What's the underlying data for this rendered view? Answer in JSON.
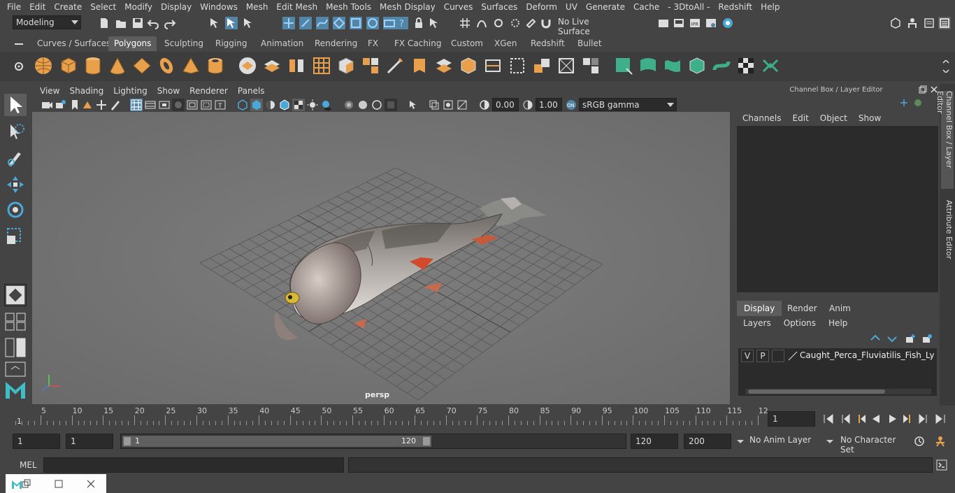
{
  "menubar": {
    "items": [
      "File",
      "Edit",
      "Create",
      "Select",
      "Modify",
      "Display",
      "Windows",
      "Mesh",
      "Edit Mesh",
      "Mesh Tools",
      "Mesh Display",
      "Curves",
      "Surfaces",
      "Deform",
      "UV",
      "Generate",
      "Cache",
      "- 3DtoAll -",
      "Redshift",
      "Help"
    ]
  },
  "statusline": {
    "mode": "Modeling",
    "live_surface": "No Live Surface"
  },
  "shelf": {
    "tabs": [
      "Curves / Surfaces",
      "Polygons",
      "Sculpting",
      "Rigging",
      "Animation",
      "Rendering",
      "FX",
      "FX Caching",
      "Custom",
      "XGen",
      "Redshift",
      "Bullet"
    ],
    "active_tab": "Polygons"
  },
  "viewport": {
    "menu": [
      "View",
      "Shading",
      "Lighting",
      "Show",
      "Renderer",
      "Panels"
    ],
    "exposure": "0.00",
    "gamma": "1.00",
    "color_space": "sRGB gamma",
    "camera_label": "persp"
  },
  "channel_box": {
    "title": "Channel Box / Layer Editor",
    "menu": [
      "Channels",
      "Edit",
      "Object",
      "Show"
    ],
    "layer_tabs": [
      "Display",
      "Render",
      "Anim"
    ],
    "active_layer_tab": "Display",
    "layer_menu": [
      "Layers",
      "Options",
      "Help"
    ],
    "layers": [
      {
        "v": "V",
        "p": "P",
        "name": "Caught_Perca_Fluviatilis_Fish_Lying_("
      }
    ]
  },
  "side_tabs": [
    "Channel Box / Layer Editor",
    "Attribute Editor"
  ],
  "timeslider": {
    "ticks": [
      "5",
      "10",
      "15",
      "20",
      "25",
      "30",
      "35",
      "40",
      "45",
      "50",
      "55",
      "60",
      "65",
      "70",
      "75",
      "80",
      "85",
      "90",
      "95",
      "100",
      "105",
      "110",
      "115",
      "12"
    ],
    "start_marker": "1",
    "current_frame": "1"
  },
  "range": {
    "start": "1",
    "playback_start": "1",
    "slider_start": "1",
    "slider_end": "120",
    "playback_end": "120",
    "end": "200",
    "anim_layer": "No Anim Layer",
    "character_set": "No Character Set"
  },
  "cmdline": {
    "label": "MEL"
  },
  "colors": {
    "accent_blue": "#5285a6",
    "shelf_orange": "#e8a04c",
    "shelf_green": "#3fae8a",
    "viewport_bg": "#777777"
  }
}
